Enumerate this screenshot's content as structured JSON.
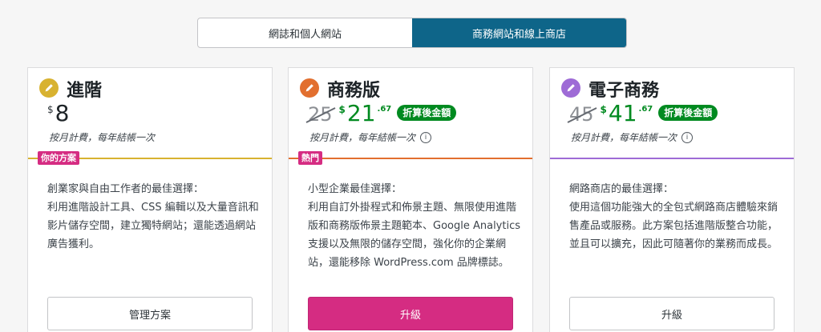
{
  "toggle": {
    "options": [
      "網誌和個人網站",
      "商務網站和線上商店"
    ],
    "active_index": 1,
    "active_color": "#0e6589"
  },
  "plans": [
    {
      "name": "進階",
      "icon": "pencil-icon",
      "icon_color": "#d8b230",
      "currency": "$",
      "old_price": null,
      "price": "8",
      "cents": "",
      "discount_label": null,
      "billing": "按月計費，每年結帳一次",
      "badge": "你的方案",
      "badge_color": "#d52c82",
      "divider_color": "#d8b230",
      "desc_title": "創業家與自由工作者的最佳選擇：",
      "desc_body": "利用進階設計工具、CSS 編輯以及大量音訊和影片儲存空間，建立獨特網站；還能透過網站廣告獲利。",
      "cta": "管理方案"
    },
    {
      "name": "商務版",
      "icon": "pencil-icon",
      "icon_color": "#e26f2f",
      "currency": "$",
      "old_price": "25",
      "price": "21",
      "cents": ".67",
      "discount_label": "折算後金額",
      "billing": "按月計費，每年結帳一次",
      "badge": "熱門",
      "badge_color": "#d52c82",
      "divider_color": "#e26f2f",
      "desc_title": "小型企業最佳選擇：",
      "desc_body": "利用自訂外掛程式和佈景主題、無限使用進階版和商務版佈景主題範本、Google Analytics 支援以及無限的儲存空間，強化你的企業網站，還能移除 WordPress.com 品牌標誌。",
      "cta": "升級"
    },
    {
      "name": "電子商務",
      "icon": "pencil-icon",
      "icon_color": "#9e6bd6",
      "currency": "$",
      "old_price": "45",
      "price": "41",
      "cents": ".67",
      "discount_label": "折算後金額",
      "billing": "按月計費，每年結帳一次",
      "badge": null,
      "badge_color": null,
      "divider_color": "#9e6bd6",
      "desc_title": "網路商店的最佳選擇：",
      "desc_body": "使用這個功能強大的全包式網路商店體驗來銷售產品或服務。此方案包括進階版整合功能，並且可以擴充，因此可隨著你的業務而成長。",
      "cta": "升級"
    }
  ]
}
